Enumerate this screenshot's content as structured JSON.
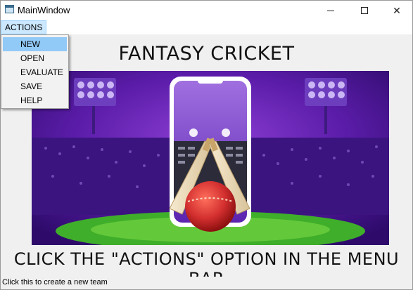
{
  "window": {
    "title": "MainWindow",
    "controls": {
      "minimize": "minimize",
      "maximize": "maximize",
      "close": "✕"
    }
  },
  "menubar": {
    "actions_label": "ACTIONS"
  },
  "menu": {
    "items": [
      {
        "label": "NEW",
        "highlighted": true
      },
      {
        "label": "OPEN"
      },
      {
        "label": "EVALUATE"
      },
      {
        "label": "SAVE"
      },
      {
        "label": "HELP"
      }
    ]
  },
  "main": {
    "heading": "FANTASY CRICKET",
    "instruction": "CLICK THE \"ACTIONS\" OPTION IN THE MENU BAR"
  },
  "statusbar": {
    "text": "Click this to create a new team"
  },
  "colors": {
    "hero_purple": "#4a148c",
    "field_green": "#3fae2a",
    "ball_red": "#c62828"
  }
}
